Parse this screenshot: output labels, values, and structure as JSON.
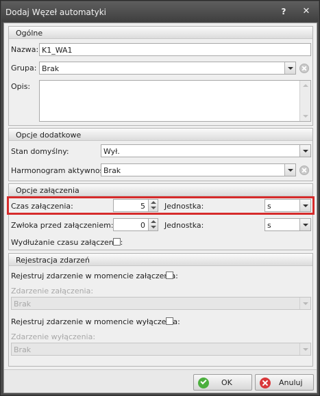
{
  "window": {
    "title": "Dodaj Węzeł automatyki",
    "help_glyph": "?",
    "close_glyph": "✕"
  },
  "general": {
    "header": "Ogólne",
    "name_label": "Nazwa:",
    "name_value": "K1_WA1",
    "group_label": "Grupa:",
    "group_value": "Brak",
    "desc_label": "Opis:",
    "desc_value": ""
  },
  "extra": {
    "header": "Opcje dodatkowe",
    "default_state_label": "Stan domyślny:",
    "default_state_value": "Wył.",
    "schedule_label": "Harmonogram aktywności:",
    "schedule_value": "Brak"
  },
  "switching": {
    "header": "Opcje załączenia",
    "on_time_label": "Czas załączenia:",
    "on_time_value": "5",
    "unit_label": "Jednostka:",
    "unit_value": "s",
    "delay_label": "Zwłoka przed załączeniem:",
    "delay_value": "0",
    "delay_unit_label": "Jednostka:",
    "delay_unit_value": "s",
    "extend_label": "Wydłużanie czasu załączenia:",
    "extend_checked": false
  },
  "events": {
    "header": "Rejestracja zdarzeń",
    "on_register_label": "Rejestruj zdarzenie w momencie załączenia:",
    "on_register_checked": false,
    "on_event_label": "Zdarzenie załączenia:",
    "on_event_value": "Brak",
    "off_register_label": "Rejestruj zdarzenie w momencie  wyłączenia:",
    "off_register_checked": false,
    "off_event_label": "Zdarzenie wyłączenia:",
    "off_event_value": "Brak"
  },
  "footer": {
    "ok_label": "OK",
    "cancel_label": "Anuluj"
  },
  "colors": {
    "highlight": "#d62b2b",
    "ok_icon": "#4caf3e",
    "cancel_icon": "#d9383a",
    "titlebar": "#4a4a4a"
  }
}
